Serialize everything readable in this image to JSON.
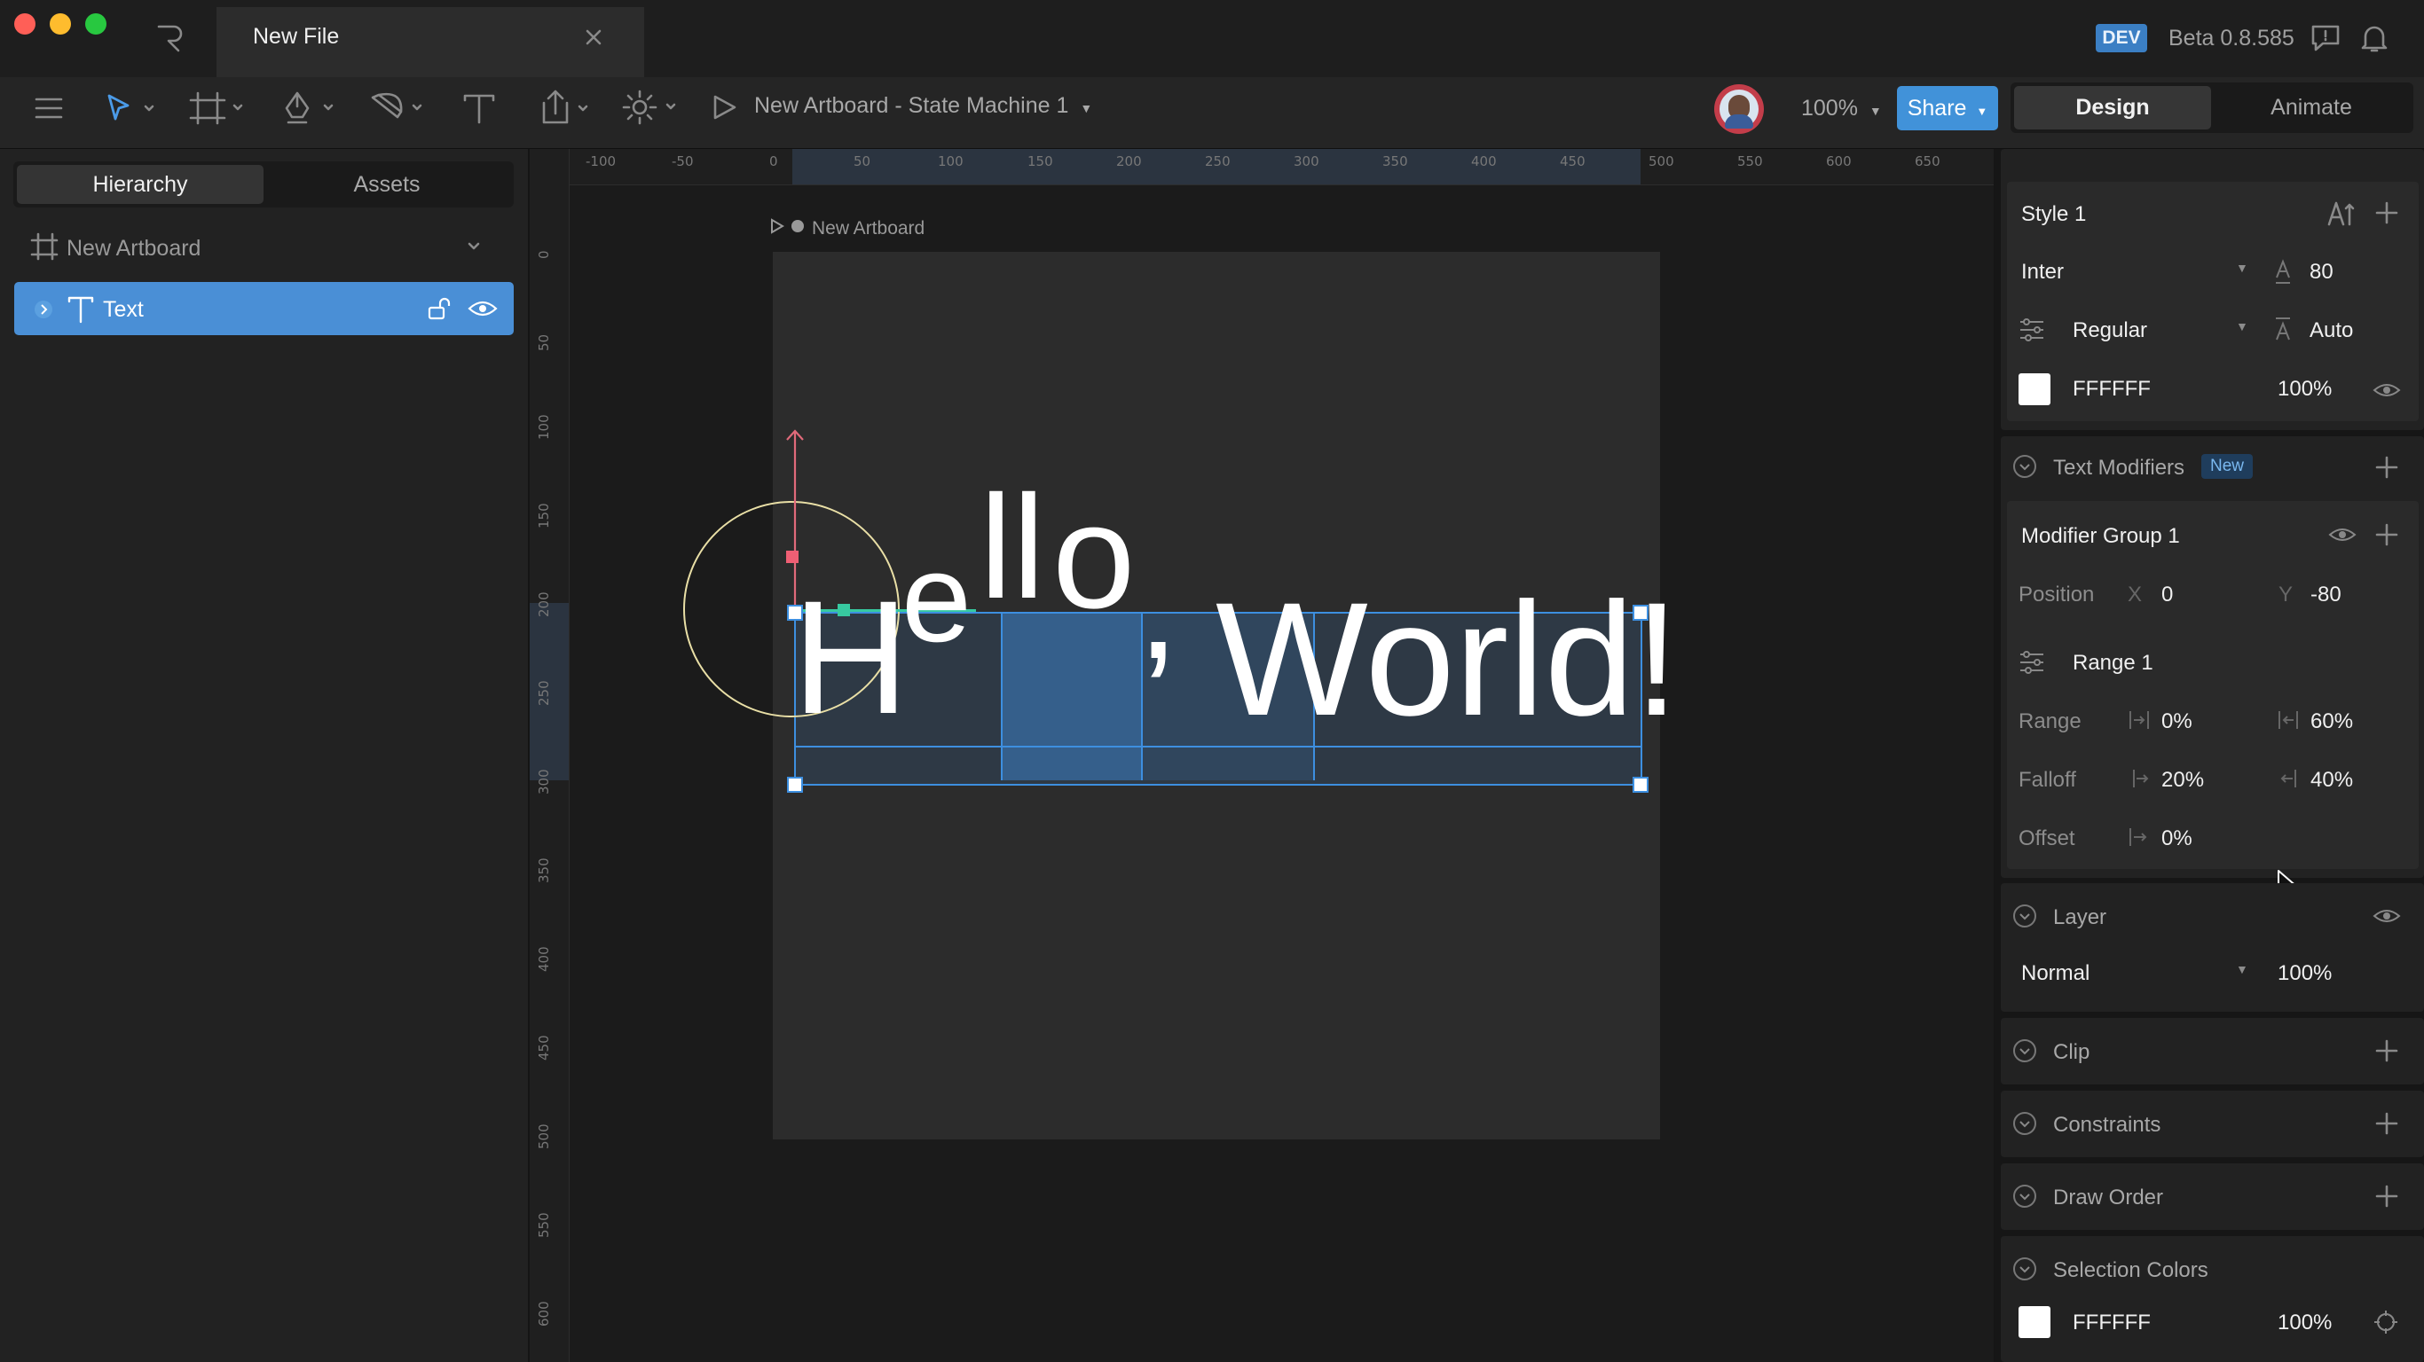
{
  "window": {
    "tab_title": "New File",
    "dev_badge": "DEV",
    "version": "Beta 0.8.585"
  },
  "toolbar": {
    "artboard_selector": "New Artboard - State Machine 1",
    "zoom": "100%",
    "share_label": "Share",
    "mode_tabs": {
      "design": "Design",
      "animate": "Animate"
    }
  },
  "left_panel": {
    "tabs": {
      "hierarchy": "Hierarchy",
      "assets": "Assets"
    },
    "artboard": "New Artboard",
    "items": [
      {
        "label": "Text"
      }
    ]
  },
  "canvas": {
    "ruler_top": [
      "-100",
      "-50",
      "0",
      "50",
      "100",
      "150",
      "200",
      "250",
      "300",
      "350",
      "400",
      "450",
      "500",
      "550",
      "600",
      "650"
    ],
    "ruler_left": [
      "0",
      "50",
      "100",
      "150",
      "200",
      "250",
      "300",
      "350",
      "400",
      "450",
      "500",
      "550",
      "600"
    ],
    "artboard_name": "New Artboard",
    "text_glyphs": {
      "h": "H",
      "e": "e",
      "ll": "ll",
      "o": "o",
      "comma": ",",
      "world": "World!"
    }
  },
  "text_styles": {
    "style_name": "Style 1",
    "font": "Inter",
    "font_size": "80",
    "weight": "Regular",
    "line_height": "Auto",
    "color_hex": "FFFFFF",
    "opacity": "100%"
  },
  "text_modifiers": {
    "title": "Text Modifiers",
    "badge": "New",
    "group_name": "Modifier Group 1",
    "position_label": "Position",
    "x_label": "X",
    "x": "0",
    "y_label": "Y",
    "y": "-80",
    "range_name": "Range 1",
    "range_label": "Range",
    "range_start": "0%",
    "range_end": "60%",
    "falloff_label": "Falloff",
    "falloff_start": "20%",
    "falloff_end": "40%",
    "offset_label": "Offset",
    "offset": "0%"
  },
  "layer": {
    "title": "Layer",
    "blend_mode": "Normal",
    "opacity": "100%"
  },
  "sections": {
    "clip": "Clip",
    "constraints": "Constraints",
    "draw_order": "Draw Order",
    "selection_colors": "Selection Colors"
  },
  "selection_colors": {
    "hex": "FFFFFF",
    "opacity": "100%"
  },
  "colors": {
    "accent": "#4192d9",
    "selection": "#3d8fe0",
    "text_white": "#FFFFFF"
  }
}
